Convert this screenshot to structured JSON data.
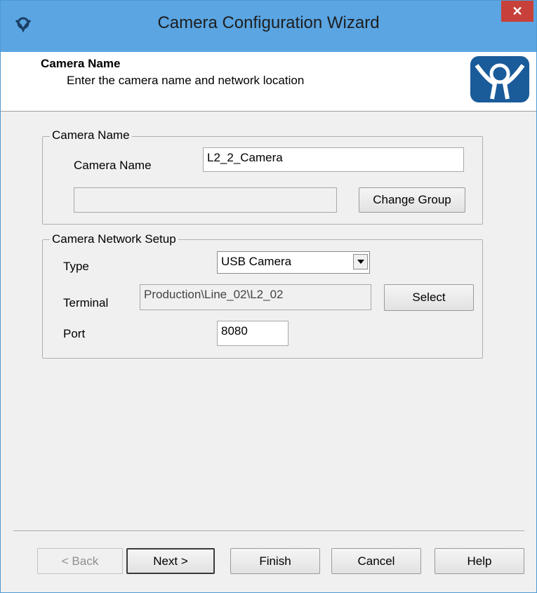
{
  "window": {
    "title": "Camera Configuration Wizard",
    "close_glyph": "✕"
  },
  "header": {
    "title": "Camera Name",
    "subtitle": "Enter the camera name and network location",
    "logo_icon": "thinmanager-logo-icon"
  },
  "camera_name_group": {
    "legend": "Camera Name",
    "name_label": "Camera Name",
    "name_value": "L2_2_Camera",
    "group_value": "",
    "change_group_label": "Change Group"
  },
  "network_group": {
    "legend": "Camera Network Setup",
    "type_label": "Type",
    "type_value": "USB Camera",
    "terminal_label": "Terminal",
    "terminal_value": "Production\\Line_02\\L2_02",
    "select_label": "Select",
    "port_label": "Port",
    "port_value": "8080"
  },
  "footer": {
    "back_label": "< Back",
    "next_label": "Next >",
    "finish_label": "Finish",
    "cancel_label": "Cancel",
    "help_label": "Help"
  },
  "colors": {
    "titlebar": "#5aa5e2",
    "close": "#c7413a",
    "logo": "#1a5b9a"
  }
}
